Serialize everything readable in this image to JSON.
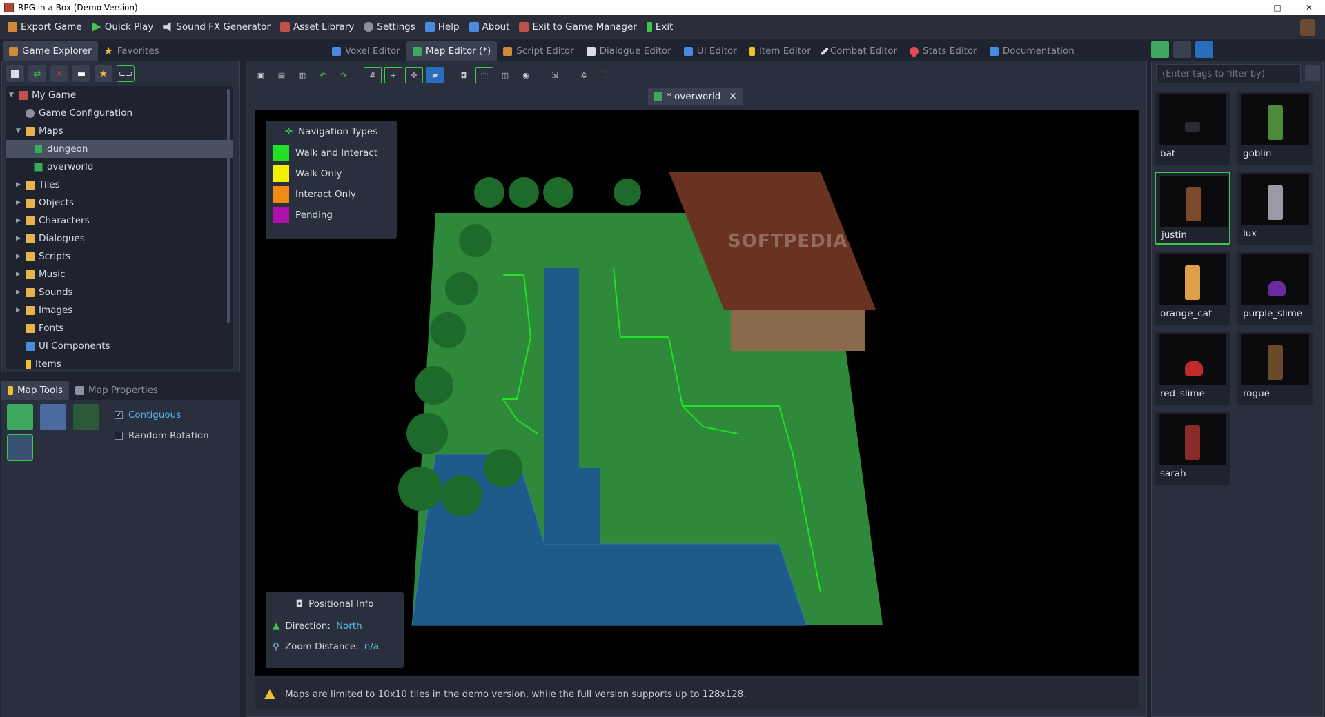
{
  "window": {
    "title": "RPG in a Box (Demo Version)",
    "minimize": "—",
    "maximize": "□",
    "close": "✕"
  },
  "menu": [
    {
      "label": "Export Game",
      "color": "#d08a3a"
    },
    {
      "label": "Quick Play",
      "color": "#3ec84a"
    },
    {
      "label": "Sound FX Generator",
      "color": "#d8dce4"
    },
    {
      "label": "Asset Library",
      "color": "#c0504a"
    },
    {
      "label": "Settings",
      "color": "#d8dce4"
    },
    {
      "label": "Help",
      "color": "#4a8ae0"
    },
    {
      "label": "About",
      "color": "#4a8ae0"
    },
    {
      "label": "Exit to Game Manager",
      "color": "#d8dce4"
    },
    {
      "label": "Exit",
      "color": "#3ec84a"
    }
  ],
  "left_tabs": [
    {
      "label": "Game Explorer"
    },
    {
      "label": "Favorites"
    }
  ],
  "editor_tabs": [
    {
      "label": "Voxel Editor"
    },
    {
      "label": "Map Editor (*)"
    },
    {
      "label": "Script Editor"
    },
    {
      "label": "Dialogue Editor"
    },
    {
      "label": "UI Editor"
    },
    {
      "label": "Item Editor"
    },
    {
      "label": "Combat Editor"
    },
    {
      "label": "Stats Editor"
    },
    {
      "label": "Documentation"
    }
  ],
  "tree": {
    "root": "My Game",
    "items": [
      {
        "label": "Game Configuration"
      },
      {
        "label": "Maps"
      },
      {
        "label": "dungeon"
      },
      {
        "label": "overworld"
      },
      {
        "label": "Tiles"
      },
      {
        "label": "Objects"
      },
      {
        "label": "Characters"
      },
      {
        "label": "Dialogues"
      },
      {
        "label": "Scripts"
      },
      {
        "label": "Music"
      },
      {
        "label": "Sounds"
      },
      {
        "label": "Images"
      },
      {
        "label": "Fonts"
      },
      {
        "label": "UI Components"
      },
      {
        "label": "Items"
      }
    ]
  },
  "map_tools": {
    "tab_tools": "Map Tools",
    "tab_props": "Map Properties",
    "contiguous": "Contiguous",
    "random_rotation": "Random Rotation"
  },
  "map_tab": {
    "label": "* overworld",
    "close": "✕"
  },
  "nav_types": {
    "title": "Navigation Types",
    "items": [
      {
        "label": "Walk and Interact",
        "color": "#22e022"
      },
      {
        "label": "Walk Only",
        "color": "#f0f000"
      },
      {
        "label": "Interact Only",
        "color": "#f08a10"
      },
      {
        "label": "Pending",
        "color": "#b010b0"
      }
    ]
  },
  "watermark": "SOFTPEDIA",
  "positional_info": {
    "title": "Positional Info",
    "direction_label": "Direction:",
    "direction_value": "North",
    "zoom_label": "Zoom Distance:",
    "zoom_value": "n/a"
  },
  "notice": "Maps are limited to 10x10 tiles in the demo version, while the full version supports up to 128x128.",
  "right_panel": {
    "filter_placeholder": "(Enter tags to filter by)",
    "characters": [
      {
        "name": "bat",
        "color": "#2a2a30"
      },
      {
        "name": "goblin",
        "color": "#4a8a3a"
      },
      {
        "name": "justin",
        "color": "#7a4a2a"
      },
      {
        "name": "lux",
        "color": "#9a9aa6"
      },
      {
        "name": "orange_cat",
        "color": "#e0a04a"
      },
      {
        "name": "purple_slime",
        "color": "#6a2aa0"
      },
      {
        "name": "red_slime",
        "color": "#c02a2a"
      },
      {
        "name": "rogue",
        "color": "#6a4a2a"
      },
      {
        "name": "sarah",
        "color": "#8a2a2a"
      }
    ]
  }
}
